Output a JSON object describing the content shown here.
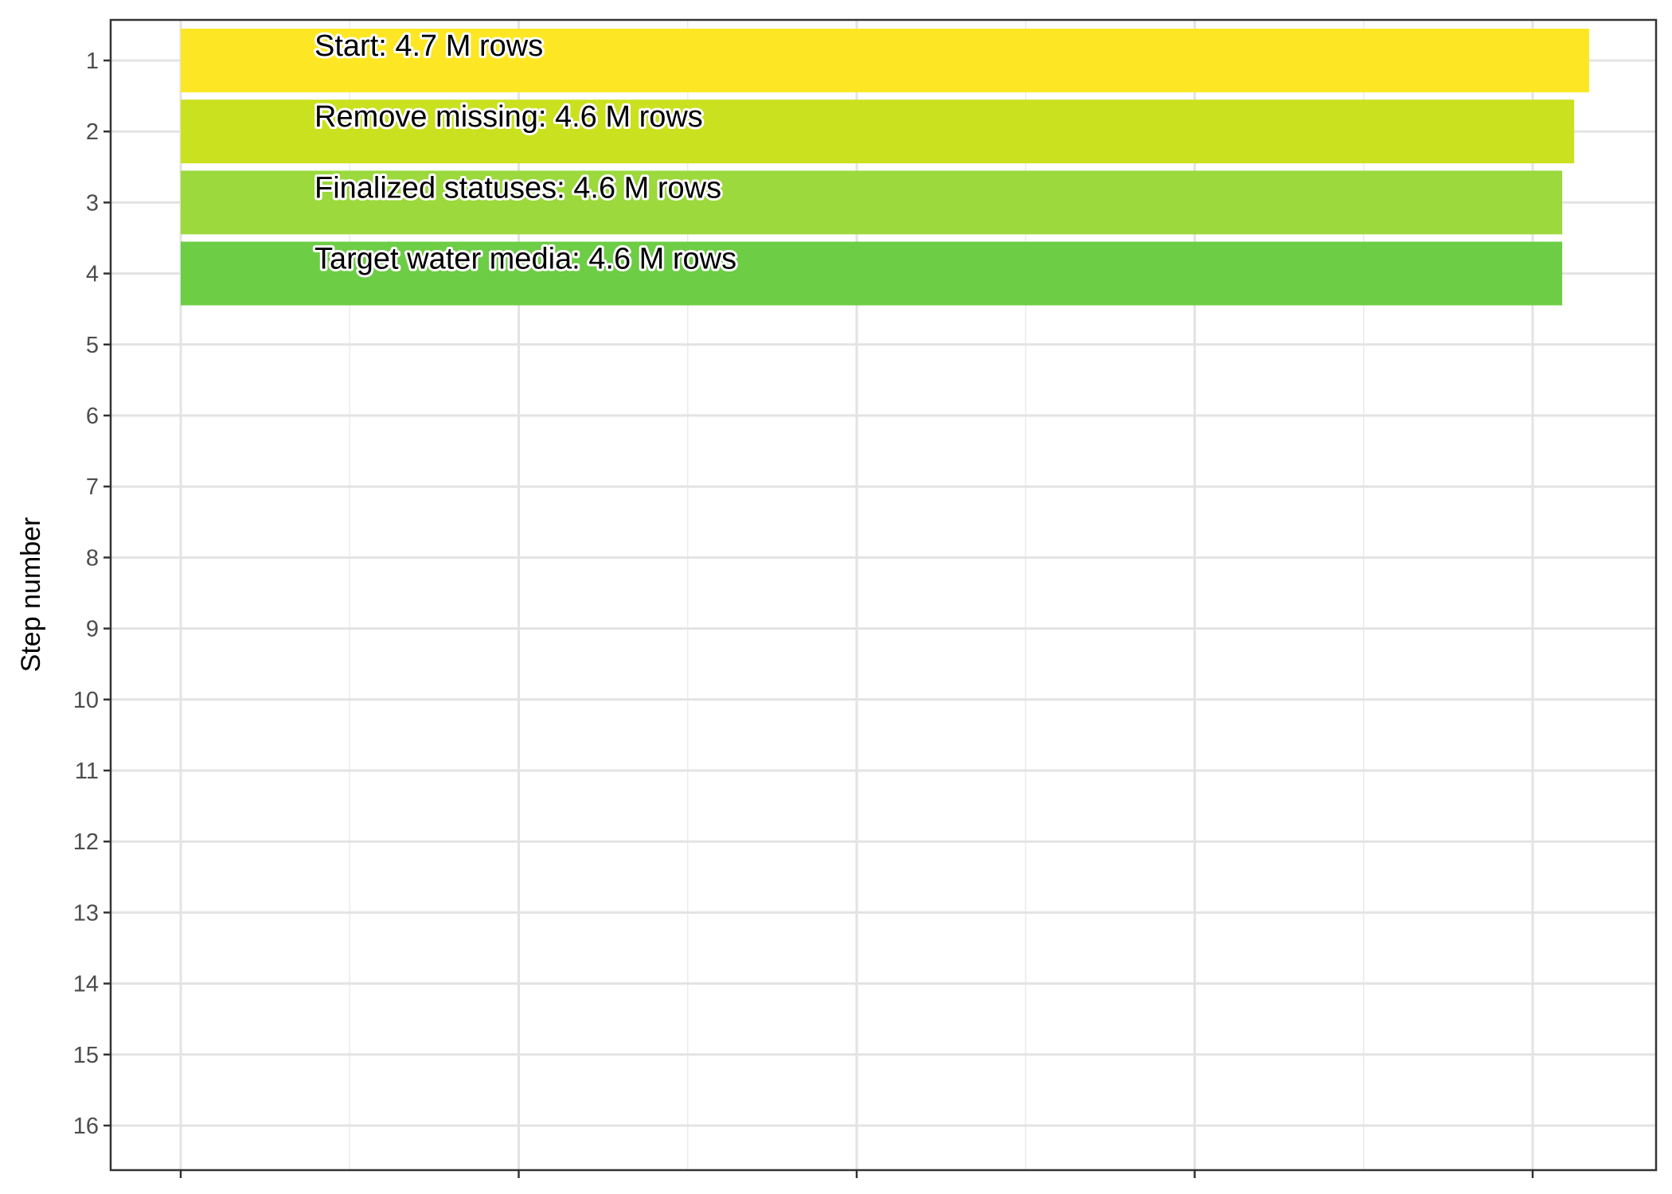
{
  "chart_data": {
    "type": "bar",
    "orientation": "horizontal",
    "ylabel": "Step number",
    "xlabel": "",
    "y_ticks": [
      "1",
      "2",
      "3",
      "4",
      "5",
      "6",
      "7",
      "8",
      "9",
      "10",
      "11",
      "12",
      "13",
      "14",
      "15",
      "16"
    ],
    "x_ticks_labelled": false,
    "x_range": [
      0,
      4.7
    ],
    "grid": true,
    "legend": "none",
    "series": [
      {
        "values": [
          4.7,
          4.65,
          4.61,
          4.61
        ],
        "steps": [
          1,
          2,
          3,
          4
        ],
        "labels": [
          "Start:  4.7 M rows",
          "Remove missing:  4.6 M rows",
          "Finalized statuses:  4.6 M rows",
          "Target water media:  4.6 M rows"
        ],
        "colors": [
          "#FDE725",
          "#CAE11F",
          "#9BD93C",
          "#6DCD45"
        ]
      }
    ]
  }
}
